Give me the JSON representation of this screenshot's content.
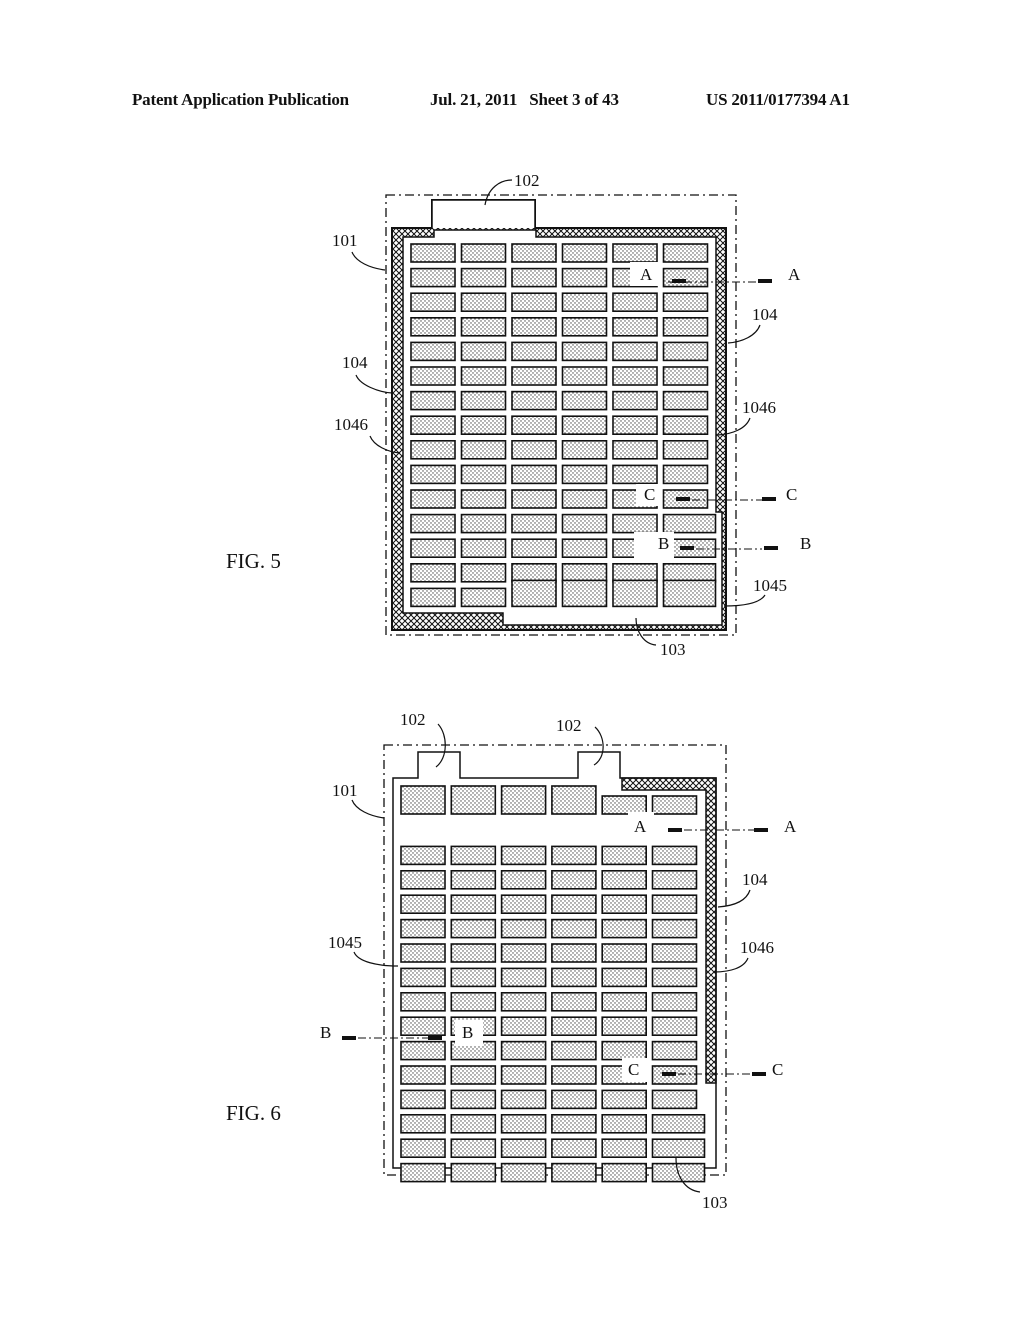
{
  "header": {
    "publication": "Patent Application Publication",
    "date_sheet": "Jul. 21, 2011   Sheet 3 of 43",
    "number": "US 2011/0177394 A1"
  },
  "figures": [
    {
      "id": "fig5",
      "caption": "FIG. 5",
      "labels": {
        "tab": "102",
        "case": "101",
        "seal_left": "104",
        "seal_right": "104",
        "hatch_left": "1046",
        "hatch_right": "1046",
        "inner": "1045",
        "cell": "103",
        "sec_a": "A",
        "sec_b": "B",
        "sec_c": "C"
      },
      "grid": {
        "rows": 15,
        "cols": 6
      }
    },
    {
      "id": "fig6",
      "caption": "FIG. 6",
      "labels": {
        "tab1": "102",
        "tab2": "102",
        "case": "101",
        "seal_right": "104",
        "hatch_right": "1046",
        "inner": "1045",
        "cell": "103",
        "sec_a": "A",
        "sec_b": "B",
        "sec_c": "C"
      },
      "grid": {
        "rows": 15,
        "cols": 6
      }
    }
  ]
}
